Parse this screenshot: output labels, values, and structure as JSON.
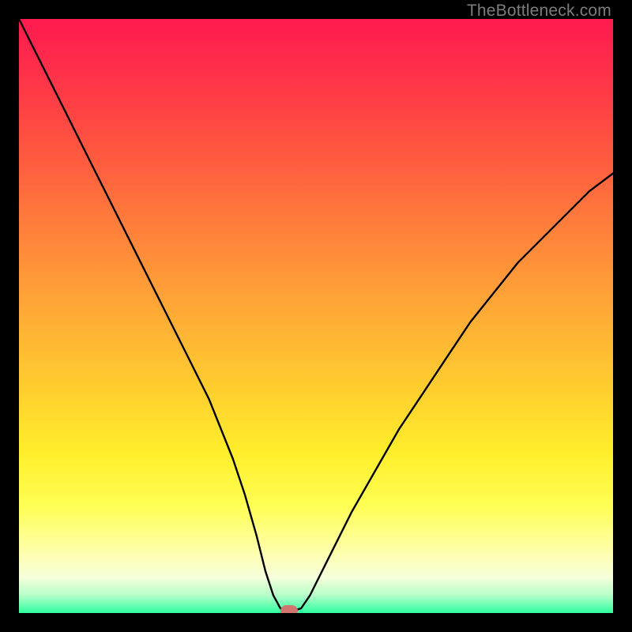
{
  "watermark": {
    "text": "TheBottleneck.com"
  },
  "chart_data": {
    "type": "line",
    "title": "",
    "xlabel": "",
    "ylabel": "",
    "xlim": [
      0,
      100
    ],
    "ylim": [
      0,
      100
    ],
    "grid": false,
    "legend": false,
    "series": [
      {
        "name": "bottleneck-curve",
        "x": [
          0,
          4,
          8,
          12,
          16,
          20,
          24,
          28,
          32,
          36,
          38,
          40,
          41.5,
          42.8,
          44,
          45,
          46,
          47.5,
          49,
          52,
          56,
          60,
          64,
          68,
          72,
          76,
          80,
          84,
          88,
          92,
          96,
          100
        ],
        "y": [
          100,
          92,
          84,
          76,
          68,
          60,
          52,
          44,
          36,
          26,
          20,
          13,
          7,
          3,
          0.8,
          0.3,
          0.3,
          0.8,
          3,
          9,
          17,
          24,
          31,
          37,
          43,
          49,
          54,
          59,
          63,
          67,
          71,
          74
        ]
      }
    ],
    "marker": {
      "x": 45.5,
      "y": 0.4
    },
    "background_gradient": {
      "orientation": "vertical",
      "stops": [
        {
          "pos": 0.0,
          "color": "#ff1a4f"
        },
        {
          "pos": 0.5,
          "color": "#ffac36"
        },
        {
          "pos": 0.82,
          "color": "#ffff55"
        },
        {
          "pos": 1.0,
          "color": "#2dffa0"
        }
      ]
    }
  }
}
